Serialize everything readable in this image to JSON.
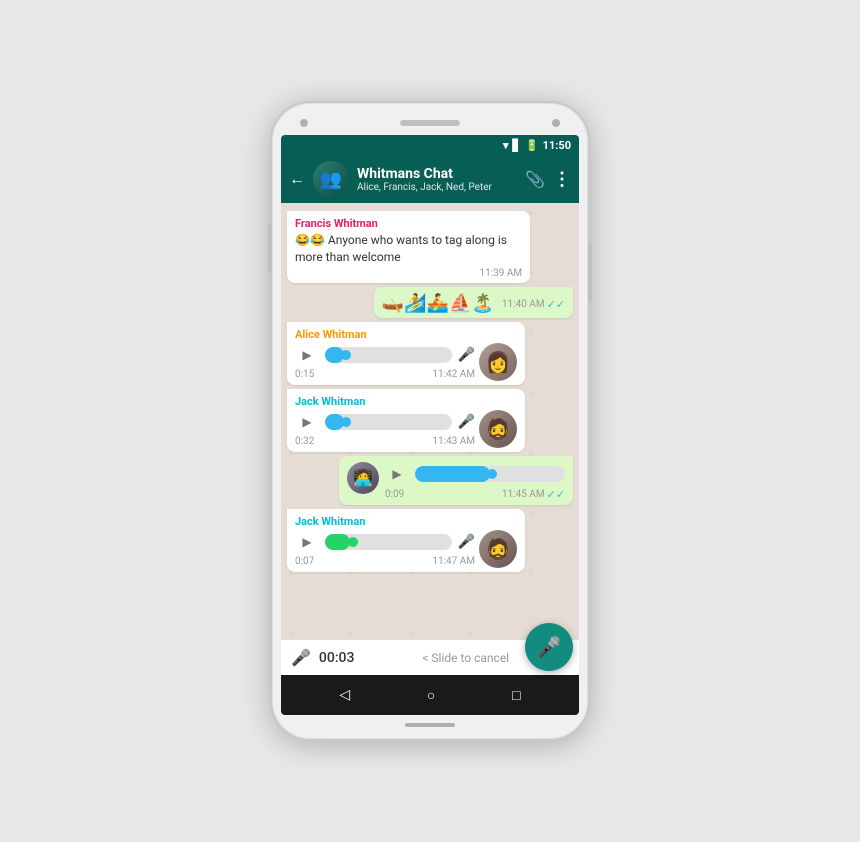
{
  "phone": {
    "status_bar": {
      "time": "11:50",
      "wifi_icon": "wifi",
      "signal_icon": "signal",
      "battery_icon": "battery"
    },
    "header": {
      "title": "Whitmans Chat",
      "members": "Alice, Francis, Jack, Ned, Peter",
      "back_label": "←",
      "attach_icon": "paperclip",
      "more_icon": "⋮"
    },
    "messages": [
      {
        "id": "msg1",
        "type": "text_incoming",
        "sender": "Francis Whitman",
        "sender_color": "francis",
        "text": "😂😂 Anyone who wants to tag along is more than welcome",
        "time": "11:39 AM",
        "ticks": false
      },
      {
        "id": "msg2",
        "type": "sticker_outgoing",
        "emojis": "🛶🏄🚣⛵🏖️",
        "time": "11:40 AM",
        "ticks": true,
        "tick_color": "blue"
      },
      {
        "id": "msg3",
        "type": "voice_incoming",
        "sender": "Alice Whitman",
        "sender_color": "alice",
        "duration": "0:15",
        "time": "11:42 AM",
        "avatar": "alice",
        "fill_percent": 15,
        "mic_color": "blue"
      },
      {
        "id": "msg4",
        "type": "voice_incoming",
        "sender": "Jack Whitman",
        "sender_color": "jack",
        "duration": "0:32",
        "time": "11:43 AM",
        "avatar": "jack",
        "fill_percent": 15,
        "mic_color": "blue"
      },
      {
        "id": "msg5",
        "type": "voice_outgoing",
        "duration": "0:09",
        "time": "11:45 AM",
        "ticks": true,
        "tick_color": "blue",
        "avatar": "glasses",
        "fill_percent": 50
      },
      {
        "id": "msg6",
        "type": "voice_incoming",
        "sender": "Jack Whitman",
        "sender_color": "jack",
        "duration": "0:07",
        "time": "11:47 AM",
        "avatar": "jack",
        "fill_percent": 20,
        "mic_color": "green"
      }
    ],
    "recording_bar": {
      "mic_label": "🎤",
      "time": "00:03",
      "cancel_text": "< Slide to cancel",
      "fab_label": "🎤"
    },
    "nav_bar": {
      "back": "◁",
      "home": "○",
      "recents": "□"
    }
  }
}
